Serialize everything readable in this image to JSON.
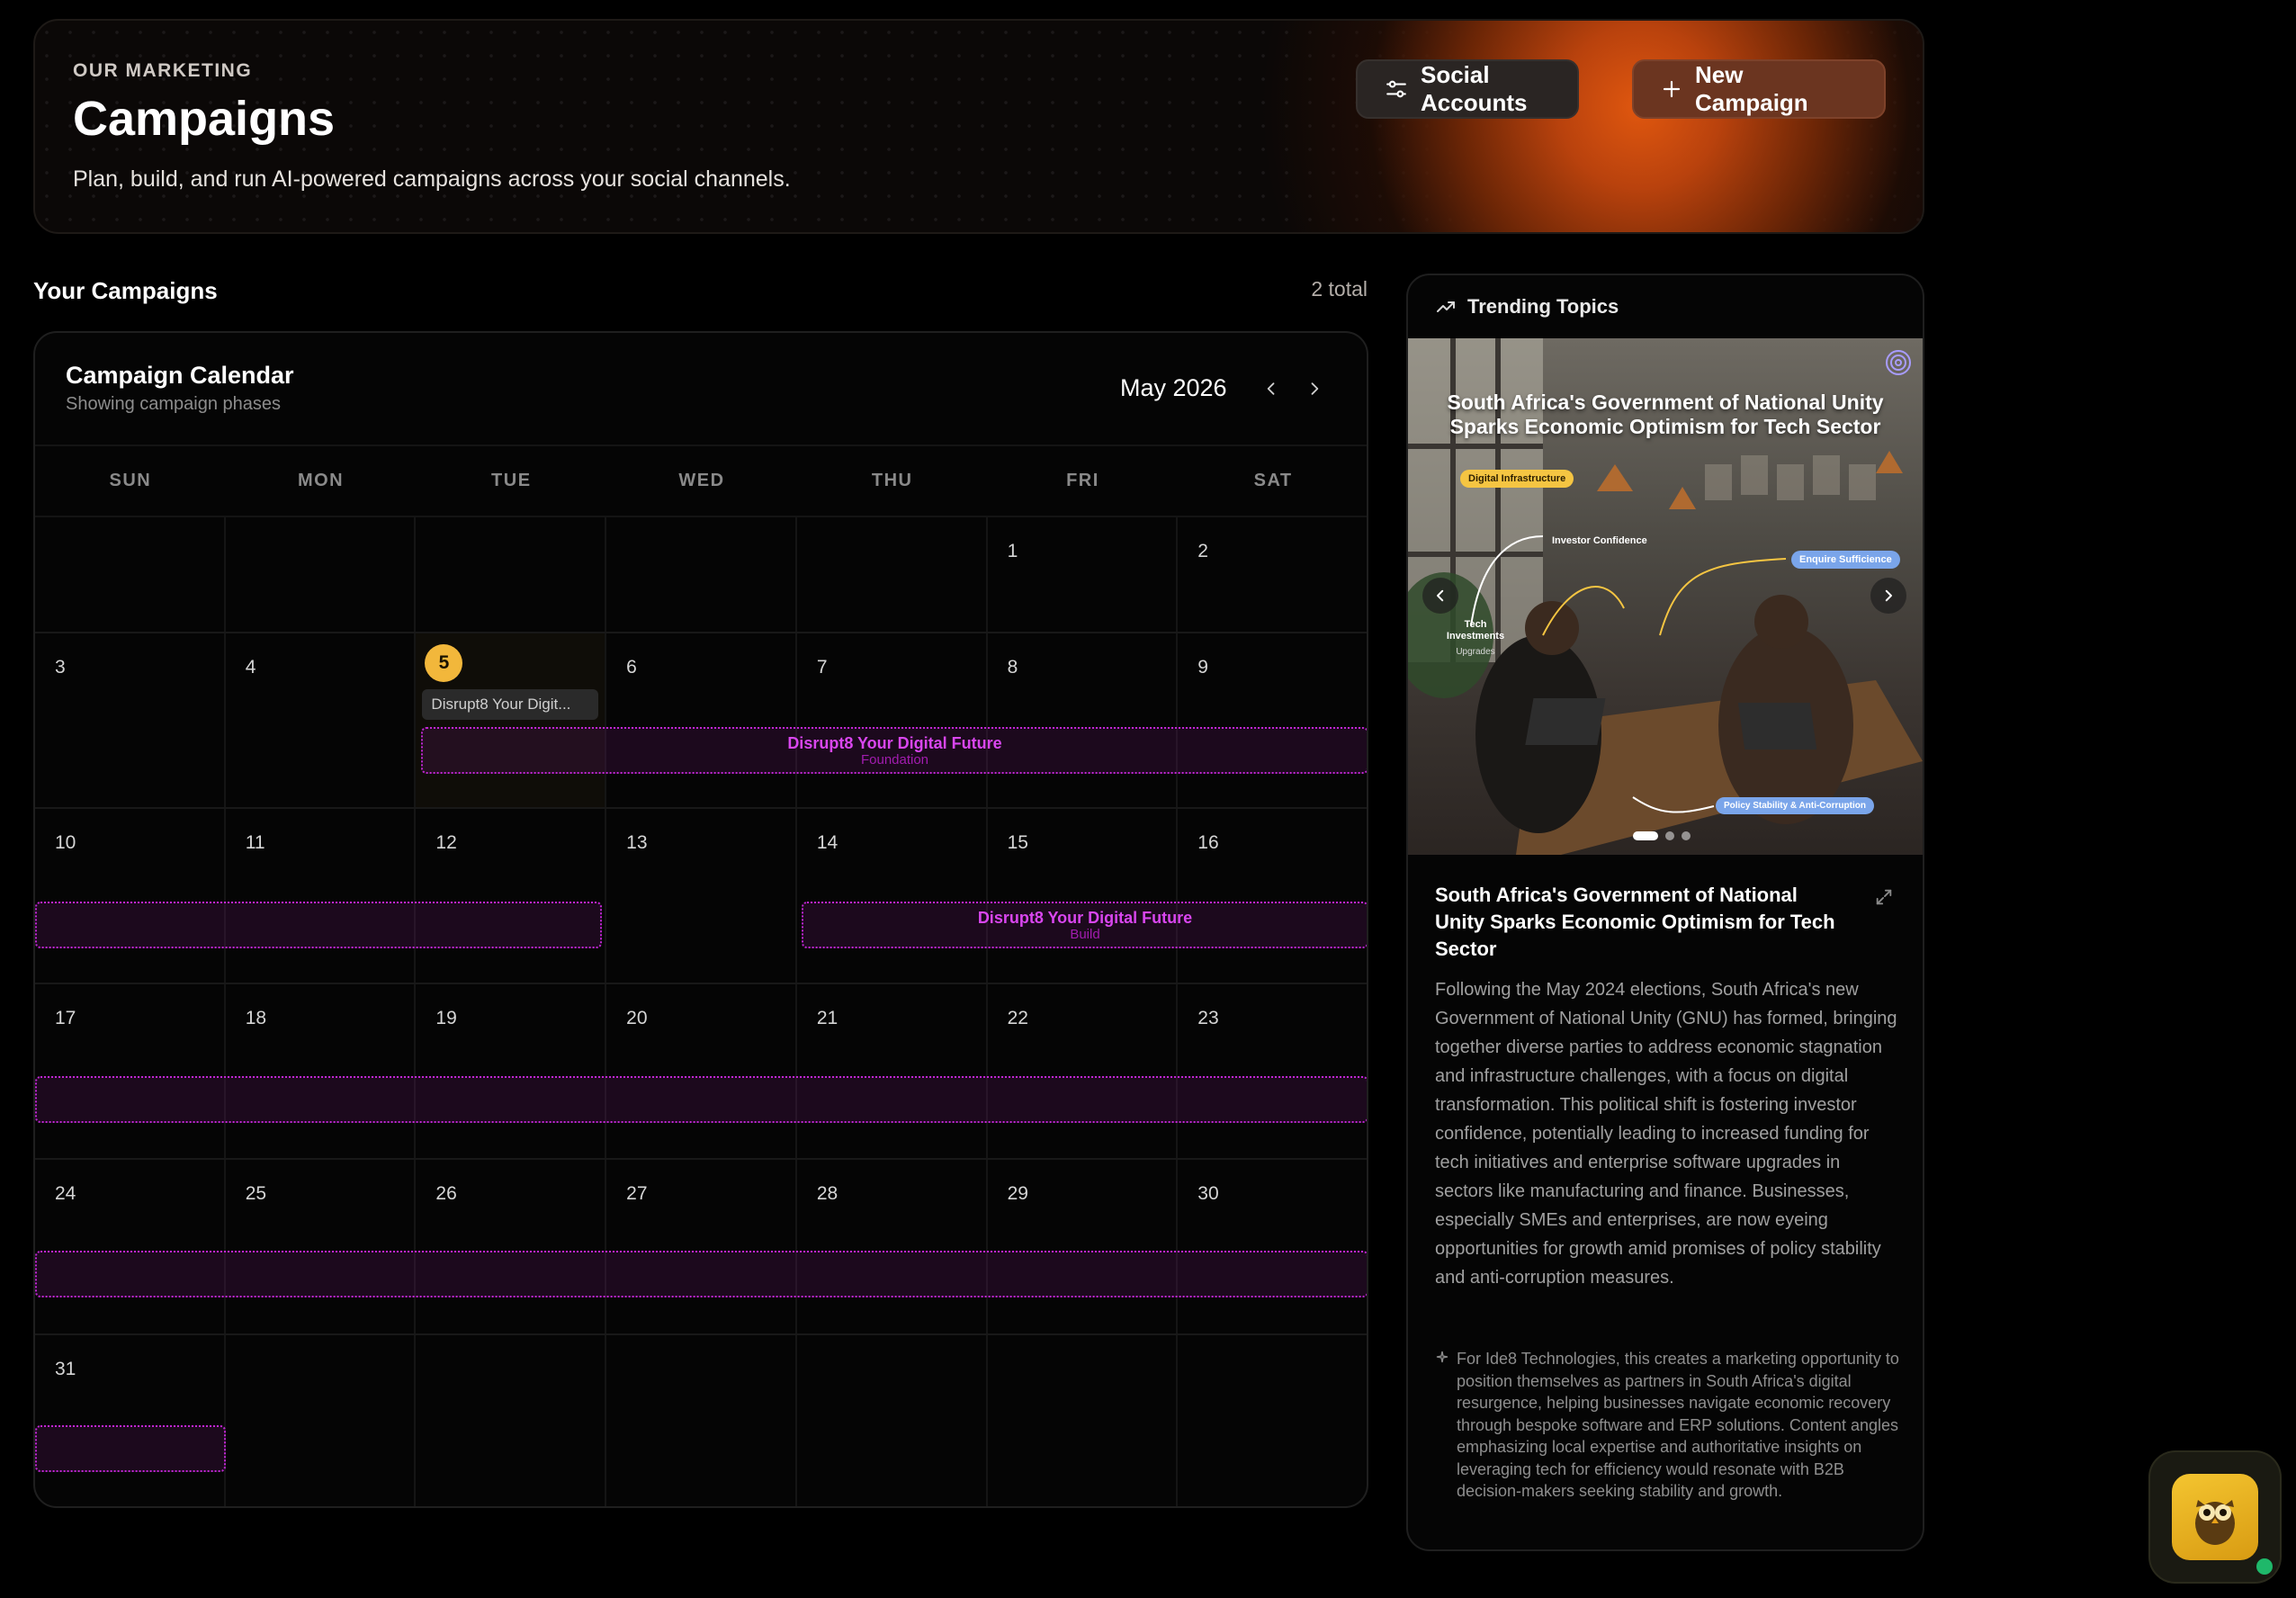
{
  "header": {
    "eyebrow": "OUR MARKETING",
    "title": "Campaigns",
    "subtitle": "Plan, build, and run AI-powered campaigns across your social channels.",
    "social_accounts_label": "Social Accounts",
    "new_campaign_label": "New Campaign",
    "accent_color": "#e0570f"
  },
  "campaigns": {
    "section_title": "Your Campaigns",
    "count_label": "2 total"
  },
  "calendar": {
    "title": "Campaign Calendar",
    "subtitle": "Showing campaign phases",
    "month_label": "May 2026",
    "weekdays": [
      "SUN",
      "MON",
      "TUE",
      "WED",
      "THU",
      "FRI",
      "SAT"
    ],
    "weeks": [
      [
        "",
        "",
        "",
        "",
        "",
        "1",
        "2"
      ],
      [
        "3",
        "4",
        "5",
        "6",
        "7",
        "8",
        "9"
      ],
      [
        "10",
        "11",
        "12",
        "13",
        "14",
        "15",
        "16"
      ],
      [
        "17",
        "18",
        "19",
        "20",
        "21",
        "22",
        "23"
      ],
      [
        "24",
        "25",
        "26",
        "27",
        "28",
        "29",
        "30"
      ],
      [
        "31",
        "",
        "",
        "",
        "",
        "",
        ""
      ]
    ],
    "today": "5",
    "today_chip": "Disrupt8 Your Digit...",
    "phases": [
      {
        "name": "Disrupt8 Your Digital Future",
        "stage": "Foundation"
      },
      {
        "name": "Disrupt8 Your Digital Future",
        "stage": "Build"
      }
    ],
    "phase_color": "#c026d3"
  },
  "trending": {
    "heading": "Trending Topics",
    "image": {
      "title": "South Africa's Government of National Unity Sparks Economic Optimism for Tech Sector",
      "tag_digital": "Digital Infrastructure",
      "label_investor": "Investor Confidence",
      "tag_enquire": "Enquire Sufficience",
      "label_tech": "Tech Investments",
      "label_upgrades": "Upgrades",
      "tag_policy": "Policy Stability & Anti-Corruption"
    },
    "article_title": "South Africa's Government of National Unity Sparks Economic Optimism for Tech Sector",
    "article_body": "Following the May 2024 elections, South Africa's new Government of National Unity (GNU) has formed, bringing together diverse parties to address economic stagnation and infrastructure challenges, with a focus on digital transformation. This political shift is fostering investor confidence, potentially leading to increased funding for tech initiatives and enterprise software upgrades in sectors like manufacturing and finance. Businesses, especially SMEs and enterprises, are now eyeing opportunities for growth amid promises of policy stability and anti-corruption measures.",
    "article_note": "For Ide8 Technologies, this creates a marketing opportunity to position themselves as partners in South Africa's digital resurgence, helping businesses navigate economic recovery through bespoke software and ERP solutions. Content angles emphasizing local expertise and authoritative insights on leveraging tech for efficiency would resonate with B2B decision-makers seeking stability and growth."
  }
}
